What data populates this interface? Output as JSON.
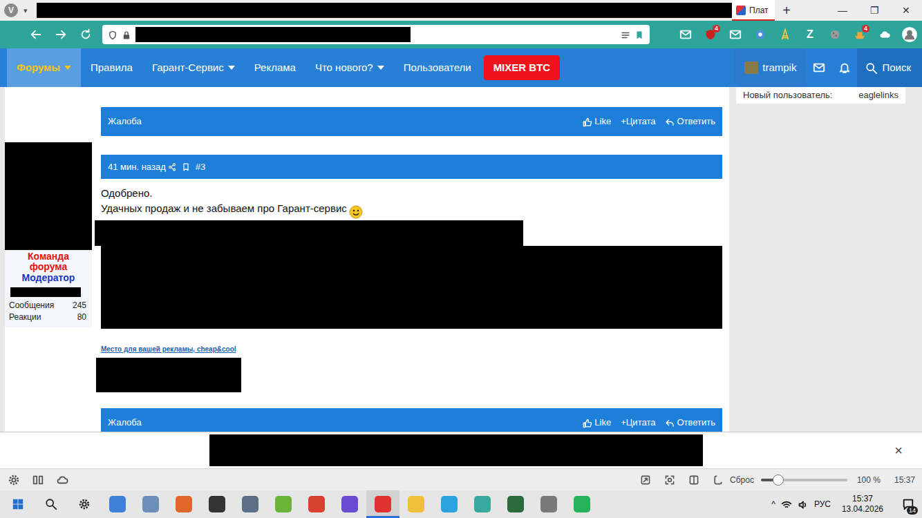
{
  "browser": {
    "logo": "V",
    "menu_caret": "▾",
    "tabs": [
      {
        "label": "Плат",
        "selected": true
      }
    ],
    "new_tab": "+",
    "window_controls": [
      "—",
      "❐",
      "✕"
    ],
    "extensions": [
      {
        "kind": "mail"
      },
      {
        "kind": "shield",
        "badge": "4"
      },
      {
        "kind": "envelope"
      },
      {
        "kind": "circle"
      },
      {
        "kind": "tower"
      },
      {
        "kind": "letter",
        "text": "Z"
      },
      {
        "kind": "cookie"
      },
      {
        "kind": "ship",
        "badge": "4"
      },
      {
        "kind": "cloud"
      },
      {
        "kind": "avatar"
      }
    ]
  },
  "forum_nav": {
    "items": [
      {
        "label": "Форумы",
        "selected": true,
        "menu": true
      },
      {
        "label": "Правила",
        "selected": false,
        "menu": false
      },
      {
        "label": "Гарант-Сервис",
        "selected": false,
        "menu": true
      },
      {
        "label": "Реклама",
        "selected": false,
        "menu": false
      },
      {
        "label": "Что нового?",
        "selected": false,
        "menu": true
      },
      {
        "label": "Пользователи",
        "selected": false,
        "menu": false
      }
    ],
    "promo": "MIXER BTC",
    "user": "trampik",
    "search": "Поиск"
  },
  "sidebar": {
    "label": "Новый пользователь:",
    "value": "eaglelinks"
  },
  "posts": [
    {
      "footer": {
        "report": "Жалоба",
        "like": "Like",
        "quote": "+Цитата",
        "reply": "Ответить"
      }
    },
    {
      "time": "41 мин. назад",
      "number": "#3",
      "author": {
        "team": "Команда форума",
        "role": "Модератор",
        "stats": [
          {
            "label": "Сообщения",
            "value": "245"
          },
          {
            "label": "Реакции",
            "value": "80"
          }
        ]
      },
      "body": [
        "Одобрено.",
        "Удачных продаж и не забываем про Гарант-сервис"
      ],
      "ad_link": "Место для вашей рекламы, cheap&cool",
      "footer": {
        "report": "Жалоба",
        "like": "Like",
        "quote": "+Цитата",
        "reply": "Ответить"
      }
    }
  ],
  "popup": {
    "close": "×"
  },
  "status_bar": {
    "reset": "Сброс",
    "zoom_level": 0.2,
    "zoom": "100 %",
    "time": "15:37"
  },
  "taskbar": {
    "apps": [
      {
        "kind": "start",
        "color": "#1f6fd1",
        "selected": false
      },
      {
        "kind": "search",
        "color": "#222222",
        "selected": false
      },
      {
        "kind": "settings",
        "color": "#222222",
        "selected": false
      },
      {
        "kind": "app",
        "color": "#3f7fd8",
        "selected": false
      },
      {
        "kind": "app",
        "color": "#6b8fb8",
        "selected": false
      },
      {
        "kind": "app",
        "color": "#e0662b",
        "selected": false
      },
      {
        "kind": "app",
        "color": "#333333",
        "selected": false
      },
      {
        "kind": "app",
        "color": "#5b6f86",
        "selected": false
      },
      {
        "kind": "app",
        "color": "#6bb43c",
        "selected": false
      },
      {
        "kind": "app",
        "color": "#d8412f",
        "selected": false
      },
      {
        "kind": "app",
        "color": "#6a4bd0",
        "selected": false
      },
      {
        "kind": "app",
        "color": "#e0322e",
        "selected": true
      },
      {
        "kind": "app",
        "color": "#f0c03c",
        "selected": false
      },
      {
        "kind": "app",
        "color": "#2aa3df",
        "selected": false
      },
      {
        "kind": "app",
        "color": "#39a9a0",
        "selected": false
      },
      {
        "kind": "app",
        "color": "#2c6b3c",
        "selected": false
      },
      {
        "kind": "app",
        "color": "#7a7a7a",
        "selected": false
      },
      {
        "kind": "app",
        "color": "#25b35a",
        "selected": false
      }
    ],
    "tray_toggle": "^",
    "language": "РУС",
    "time": "15:37",
    "date": "13.04.2026",
    "notifications": "14"
  }
}
